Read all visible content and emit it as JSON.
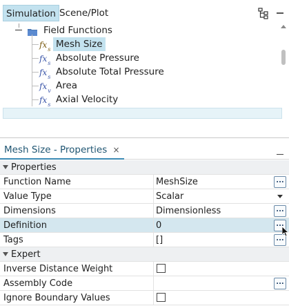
{
  "tabs": {
    "simulation": "Simulation",
    "scene_plot": "Scene/Plot"
  },
  "tree": {
    "folder_label": "Field Functions",
    "items": [
      {
        "label": "Mesh Size",
        "icon": "fx-s"
      },
      {
        "label": "Absolute Pressure",
        "icon": "fx-s"
      },
      {
        "label": "Absolute Total Pressure",
        "icon": "fx-s"
      },
      {
        "label": "Area",
        "icon": "fx-v"
      },
      {
        "label": "Axial Velocity",
        "icon": "fx-s"
      }
    ]
  },
  "properties_panel": {
    "tab_title": "Mesh Size - Properties",
    "close_glyph": "×",
    "sections": [
      {
        "title": "Properties",
        "rows": [
          {
            "name": "Function Name",
            "value": "MeshSize",
            "control": "ellipsis"
          },
          {
            "name": "Value Type",
            "value": "Scalar",
            "control": "dropdown"
          },
          {
            "name": "Dimensions",
            "value": "Dimensionless",
            "control": "ellipsis"
          },
          {
            "name": "Definition",
            "value": "0",
            "control": "ellipsis"
          },
          {
            "name": "Tags",
            "value": "[]",
            "control": "ellipsis"
          }
        ]
      },
      {
        "title": "Expert",
        "rows": [
          {
            "name": "Inverse Distance Weight",
            "value": "",
            "control": "checkbox"
          },
          {
            "name": "Assembly Code",
            "value": "",
            "control": "ellipsis"
          },
          {
            "name": "Ignore Boundary Values",
            "value": "",
            "control": "checkbox"
          }
        ]
      }
    ],
    "ellipsis_label": "..."
  },
  "colors": {
    "selection": "#c3e2ef",
    "highlight_row": "#d4e7ef",
    "icon_blue": "#3a55a8"
  }
}
